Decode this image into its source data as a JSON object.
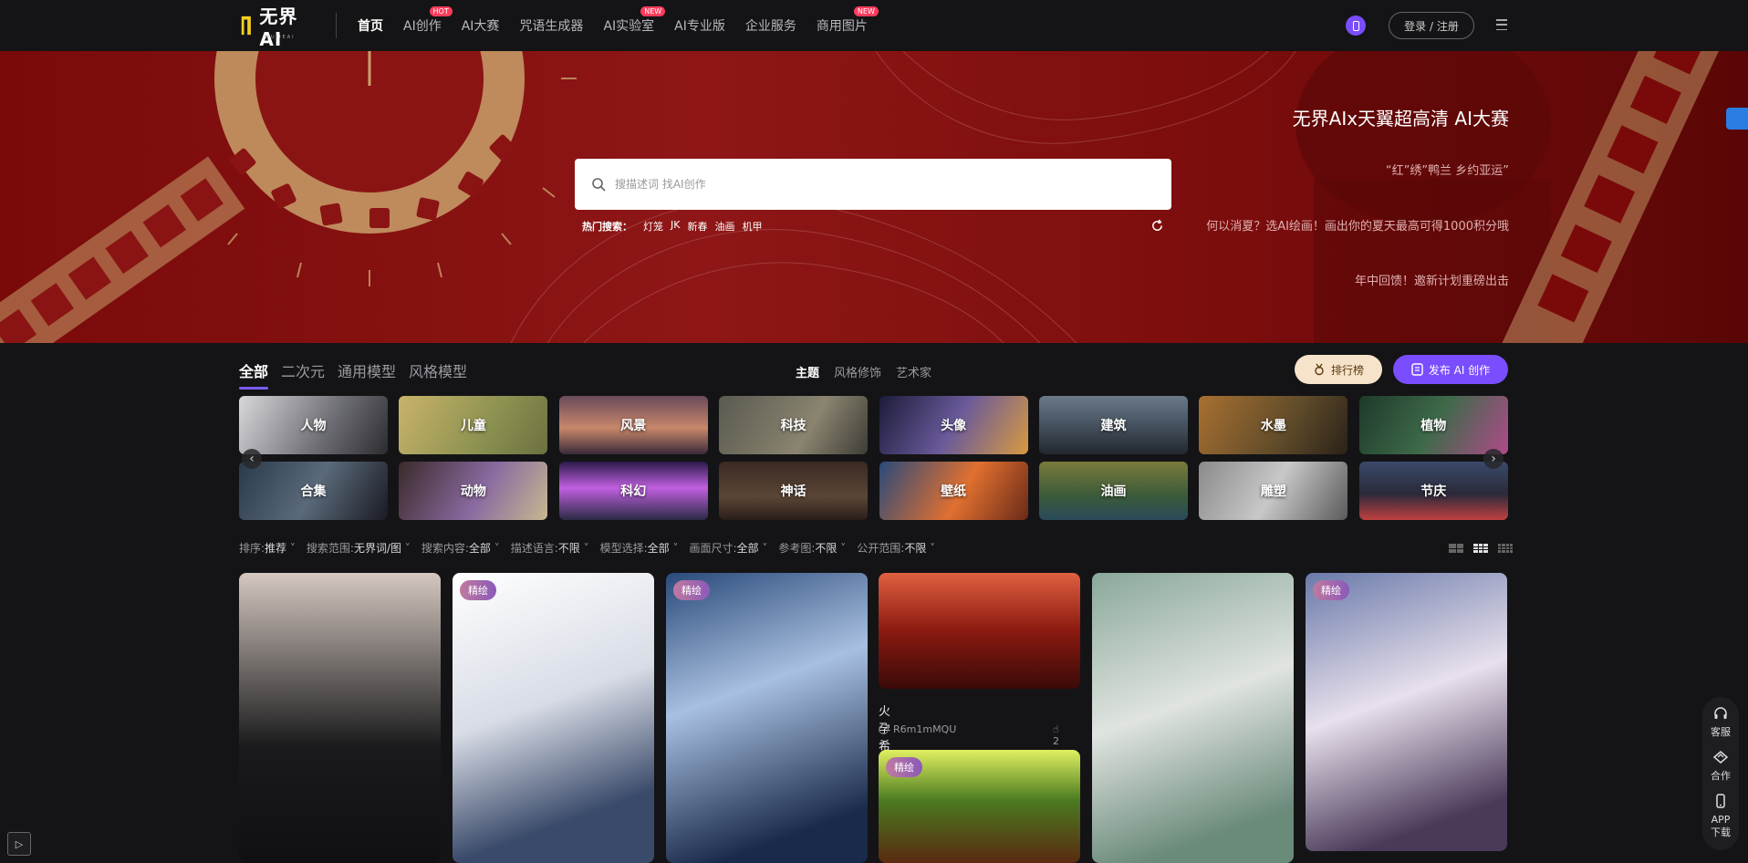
{
  "nav": {
    "logo_text": "无界AI",
    "logo_sub": "WUJIEAI",
    "links": [
      {
        "label": "首页",
        "badge": ""
      },
      {
        "label": "AI创作",
        "badge": "HOT"
      },
      {
        "label": "AI大赛",
        "badge": ""
      },
      {
        "label": "咒语生成器",
        "badge": ""
      },
      {
        "label": "AI实验室",
        "badge": "NEW"
      },
      {
        "label": "AI专业版",
        "badge": ""
      },
      {
        "label": "企业服务",
        "badge": ""
      },
      {
        "label": "商用图片",
        "badge": "NEW"
      }
    ],
    "login_label": "登录 / 注册",
    "phone_icon": "phone-icon",
    "menu_icon": "menu-icon"
  },
  "banner": {
    "search_placeholder": "搜描述词 找AI创作",
    "hot_label": "热门搜索：",
    "hot_terms": [
      "灯笼",
      "JK",
      "新春",
      "油画",
      "机甲"
    ],
    "title": "无界AIx天翼超高清 AI大赛",
    "sub1": "“红”绣”鸭兰 乡约亚运”",
    "sub2": "何以消夏？选AI绘画！画出你的夏天最高可得1000积分哦",
    "sub3": "年中回馈！邀新计划重磅出击",
    "accent": "#8e1616"
  },
  "category_tabs": [
    "全部",
    "二次元",
    "通用模型",
    "风格模型"
  ],
  "mid_tabs": [
    "主题",
    "风格修饰",
    "艺术家"
  ],
  "rank_label": "排行榜",
  "publish_label": "发布 AI 创作",
  "categories": [
    {
      "label": "人物",
      "bg": "linear-gradient(120deg,#d8d8dc,#6b6b72 60%,#2c2c30)"
    },
    {
      "label": "儿童",
      "bg": "linear-gradient(120deg,#c9b36a,#8b9150 60%,#6d7040)"
    },
    {
      "label": "风景",
      "bg": "linear-gradient(180deg,#6a4a5a,#c8876a 55%,#3a2a3a)"
    },
    {
      "label": "科技",
      "bg": "linear-gradient(120deg,#5a5a50,#8a8470 60%,#3e3c36)"
    },
    {
      "label": "头像",
      "bg": "linear-gradient(120deg,#1c1c3a,#6a5a9a 50%,#d89a40)"
    },
    {
      "label": "建筑",
      "bg": "linear-gradient(180deg,#6a7a8a,#3e4a56 60%,#22282e)"
    },
    {
      "label": "水墨",
      "bg": "linear-gradient(120deg,#a87030,#5e4a2a 60%,#2a2218)"
    },
    {
      "label": "植物",
      "bg": "linear-gradient(120deg,#1e3a2a,#3e6a4a 50%,#b04a8a)"
    },
    {
      "label": "合集",
      "bg": "linear-gradient(120deg,#2a3a4a,#5a6a7a 50%,#1a1a22)"
    },
    {
      "label": "动物",
      "bg": "linear-gradient(120deg,#3a2a2a,#8a6aa0 55%,#c8b890)"
    },
    {
      "label": "科幻",
      "bg": "linear-gradient(180deg,#2a1a4a,#c060e0 45%,#2a2a44)"
    },
    {
      "label": "神话",
      "bg": "linear-gradient(180deg,#3a2a22,#5a4636 60%,#2a1e18)"
    },
    {
      "label": "壁纸",
      "bg": "linear-gradient(120deg,#2a4a7a,#e07030 55%,#6a2a18)"
    },
    {
      "label": "油画",
      "bg": "linear-gradient(180deg,#7a7a3a,#3a5a3a 60%,#2a4a5a)"
    },
    {
      "label": "雕塑",
      "bg": "linear-gradient(120deg,#8a8a8a,#c8c8c8 50%,#5a5a5a)"
    },
    {
      "label": "节庆",
      "bg": "linear-gradient(180deg,#3a4a6a,#2a2a3a 55%,#c04040)"
    }
  ],
  "filters": [
    {
      "label": "排序:",
      "value": "推荐"
    },
    {
      "label": "搜索范围:",
      "value": "无界词/图"
    },
    {
      "label": "搜索内容:",
      "value": "全部"
    },
    {
      "label": "描述语言:",
      "value": "不限"
    },
    {
      "label": "模型选择:",
      "value": "全部"
    },
    {
      "label": "画面尺寸:",
      "value": "全部"
    },
    {
      "label": "参考图:",
      "value": "不限"
    },
    {
      "label": "公开范围:",
      "value": "不限"
    }
  ],
  "gallery": [
    {
      "tag": "",
      "title": "",
      "user": "",
      "likes": "",
      "bg": "linear-gradient(180deg,#d4c8c0,#1a1a1c 60%,#101012)"
    },
    {
      "tag": "精绘",
      "title": "",
      "user": "",
      "likes": "",
      "bg": "linear-gradient(160deg,#ffffff,#d8dce6 45%,#3a4a6a 80%)"
    },
    {
      "tag": "精绘",
      "title": "",
      "user": "",
      "likes": "",
      "bg": "linear-gradient(160deg,#2a4a7a,#a8c0e0 40%,#1a2a4a 85%)"
    },
    {
      "tag": "",
      "title": "火孕希望",
      "user": "R6m1mMQU",
      "likes": "2",
      "bg": "linear-gradient(180deg,#e06040,#8a1a10 50%,#3a0a08)"
    },
    {
      "tag": "精绘",
      "title": "",
      "user": "",
      "likes": "",
      "bg": "linear-gradient(180deg,#e0f060,#4a7a20 45%,#5a2a10)"
    },
    {
      "tag": "",
      "title": "",
      "user": "",
      "likes": "",
      "bg": "linear-gradient(160deg,#8aa89a,#e0e4e0 45%,#6a8a7a 85%)"
    },
    {
      "tag": "精绘",
      "title": "",
      "user": "",
      "likes": "",
      "bg": "linear-gradient(160deg,#6a7aaa,#e8e0ec 45%,#4a3a5a 85%)"
    }
  ],
  "float_panel": [
    {
      "label": "客服",
      "icon": "headset-icon"
    },
    {
      "label": "合作",
      "icon": "handshake-icon"
    },
    {
      "label": "APP\n下载",
      "icon": "phone-icon"
    }
  ]
}
